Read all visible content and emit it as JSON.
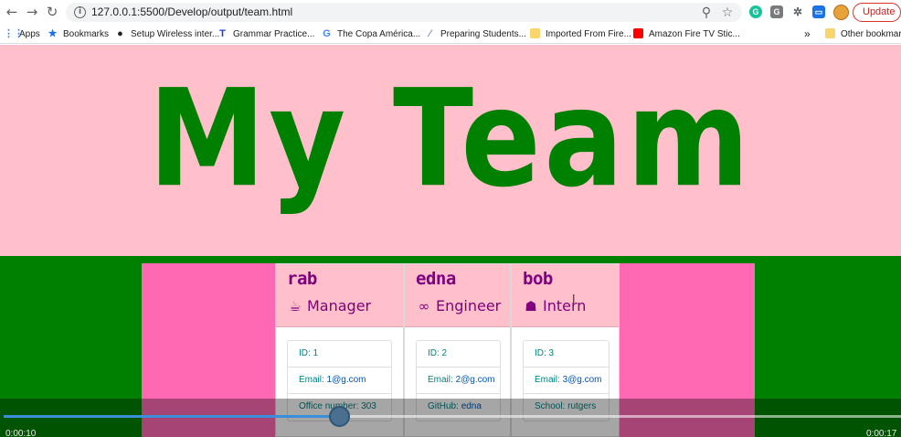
{
  "browser": {
    "url": "127.0.0.1:5500/Develop/output/team.html",
    "update_label": "Update",
    "bookmarks": [
      {
        "label": "Apps",
        "icon": "apps-grid-icon"
      },
      {
        "label": "Bookmarks",
        "icon": "star-icon"
      },
      {
        "label": "Setup Wireless inter...",
        "icon": "penguin-icon"
      },
      {
        "label": "Grammar Practice...",
        "icon": "t-logo-icon"
      },
      {
        "label": "The Copa América...",
        "icon": "google-icon"
      },
      {
        "label": "Preparing Students...",
        "icon": "feather-icon"
      },
      {
        "label": "Imported From Fire...",
        "icon": "folder-icon"
      },
      {
        "label": "Amazon Fire TV Stic...",
        "icon": "youtube-icon"
      }
    ],
    "overflow_label": "»",
    "other_bookmarks": "Other bookmarks"
  },
  "header": {
    "title": "My Team"
  },
  "team": [
    {
      "name": "rab",
      "role": "Manager",
      "role_icon": "mug-icon",
      "id_text": "ID: 1",
      "email_prefix": "Email: ",
      "email": "1@g.com",
      "extra_prefix": "Office number: ",
      "extra_value": "303"
    },
    {
      "name": "edna",
      "role": "Engineer",
      "role_icon": "glasses-icon",
      "id_text": "ID: 2",
      "email_prefix": "Email: ",
      "email": "2@g.com",
      "extra_prefix": "GitHub: ",
      "extra_value": "edna"
    },
    {
      "name": "bob",
      "role": "Intern",
      "role_icon": "graduate-icon",
      "id_text": "ID: 3",
      "email_prefix": "Email: ",
      "email": "3@g.com",
      "extra_prefix": "School: ",
      "extra_value": "rutgers"
    }
  ],
  "video": {
    "current_time": "0:00:10",
    "total_time": "0:00:17",
    "progress": 0.37
  },
  "colors": {
    "jumbotron": "#ffc0cb",
    "title": "#008000",
    "band": "#008000",
    "panel": "#ff69b4",
    "card_text": "#800080"
  }
}
